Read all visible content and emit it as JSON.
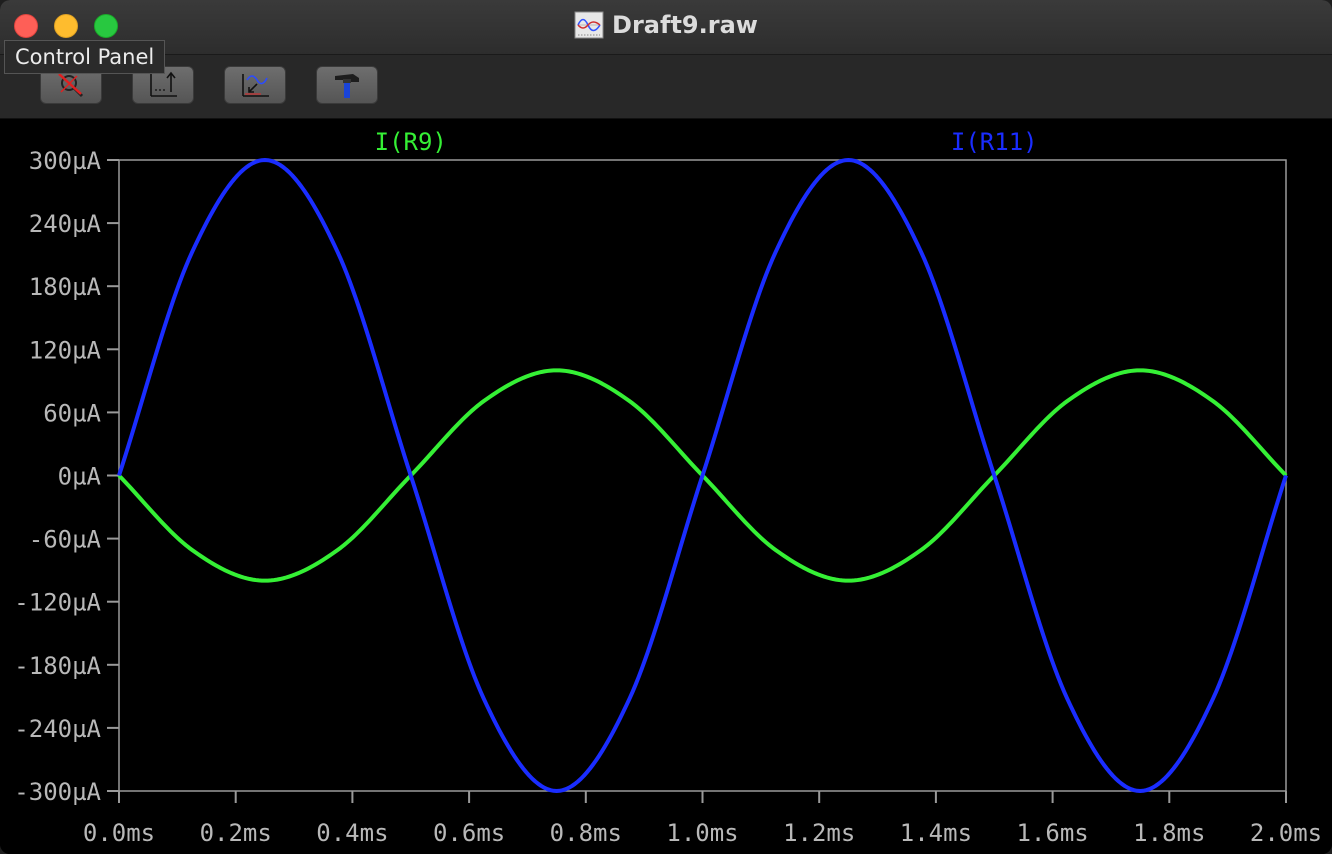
{
  "window": {
    "title": "Draft9.raw",
    "tooltip": "Control Panel"
  },
  "toolbar": {
    "buttons": [
      {
        "name": "autoscale-tool",
        "icon": "magnifier-crossed-icon"
      },
      {
        "name": "axis-scale-tool",
        "icon": "axis-scale-icon"
      },
      {
        "name": "plot-settings-tool",
        "icon": "waveform-plot-icon"
      },
      {
        "name": "control-panel-tool",
        "icon": "hammer-icon"
      }
    ]
  },
  "chart_data": {
    "type": "line",
    "title": "",
    "xlabel": "",
    "ylabel": "",
    "xlim": [
      0.0,
      2.0
    ],
    "ylim": [
      -300,
      300
    ],
    "x_unit": "ms",
    "y_unit": "µA",
    "x_ticks": [
      "0.0ms",
      "0.2ms",
      "0.4ms",
      "0.6ms",
      "0.8ms",
      "1.0ms",
      "1.2ms",
      "1.4ms",
      "1.6ms",
      "1.8ms",
      "2.0ms"
    ],
    "y_ticks": [
      "300µA",
      "240µA",
      "180µA",
      "120µA",
      "60µA",
      "0µA",
      "-60µA",
      "-120µA",
      "-180µA",
      "-240µA",
      "-300µA"
    ],
    "grid": false,
    "series": [
      {
        "name": "I(R9)",
        "color": "#35f035",
        "x": [
          0.0,
          0.125,
          0.25,
          0.375,
          0.5,
          0.625,
          0.75,
          0.875,
          1.0,
          1.125,
          1.25,
          1.375,
          1.5,
          1.625,
          1.75,
          1.875,
          2.0
        ],
        "values": [
          0,
          -70.7,
          -100,
          -70.7,
          0,
          70.7,
          100,
          70.7,
          0,
          -70.7,
          -100,
          -70.7,
          0,
          70.7,
          100,
          70.7,
          0
        ]
      },
      {
        "name": "I(R11)",
        "color": "#1a2dff",
        "x": [
          0.0,
          0.125,
          0.25,
          0.375,
          0.5,
          0.625,
          0.75,
          0.875,
          1.0,
          1.125,
          1.25,
          1.375,
          1.5,
          1.625,
          1.75,
          1.875,
          2.0
        ],
        "values": [
          0,
          212.1,
          300,
          212.1,
          0,
          -212.1,
          -300,
          -212.1,
          0,
          212.1,
          300,
          212.1,
          0,
          -212.1,
          -300,
          -212.1,
          0
        ]
      }
    ]
  }
}
